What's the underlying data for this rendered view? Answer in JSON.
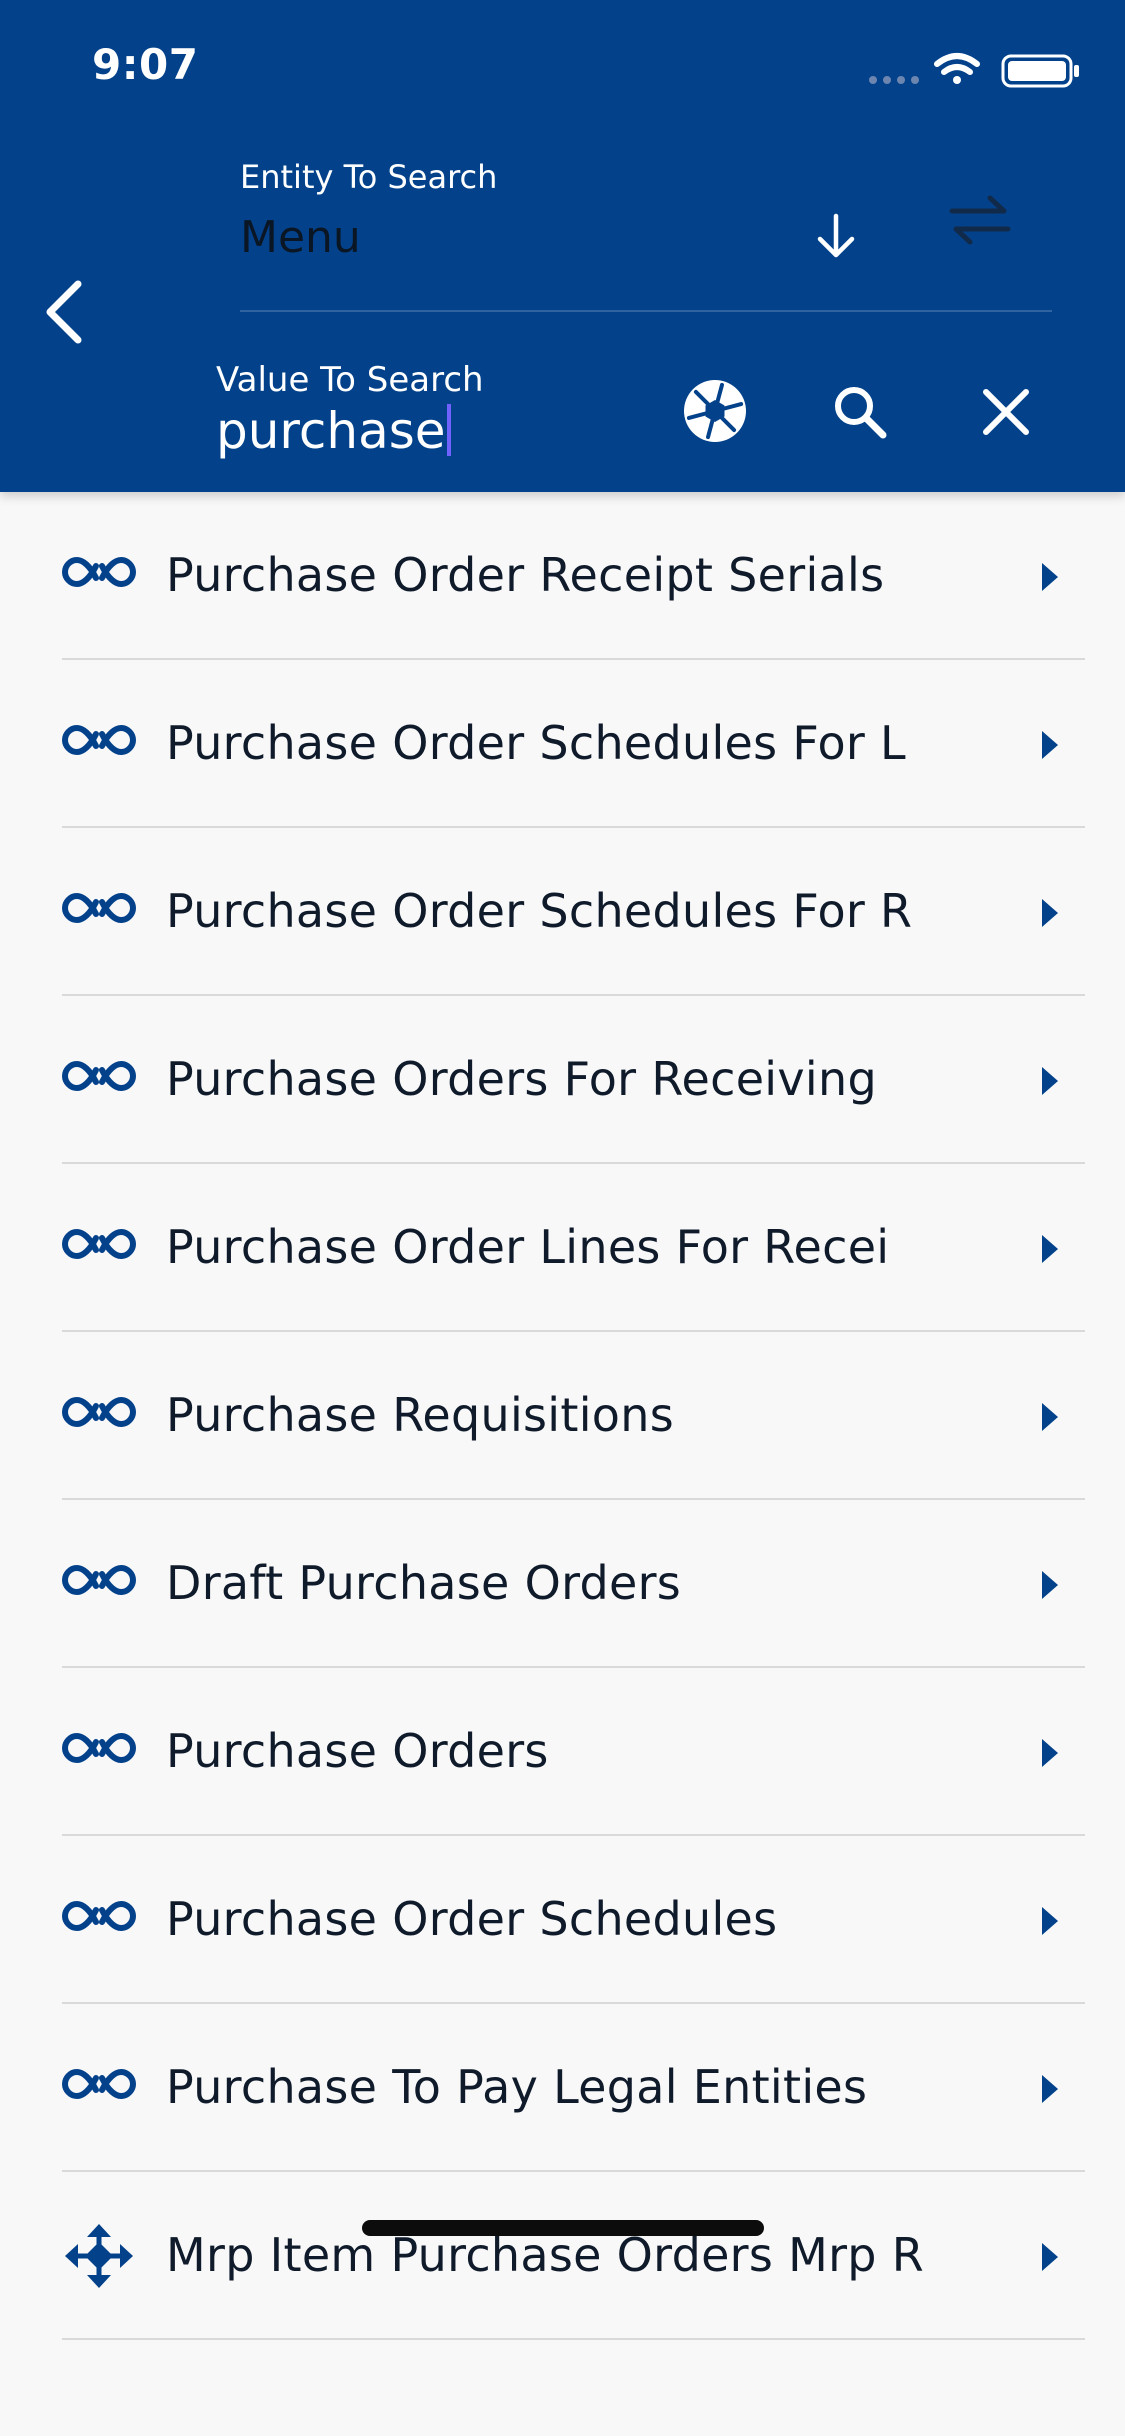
{
  "status_bar": {
    "time": "9:07",
    "icons": [
      "cellular-signal-icon",
      "wifi-icon",
      "battery-icon"
    ]
  },
  "header": {
    "background_color": "#03428b",
    "entity_label": "Entity To Search",
    "entity_value": "Menu",
    "value_label": "Value To Search",
    "value_input": "purchase",
    "caret_color": "#6f62ff",
    "icons": {
      "back": "back-chevron-icon",
      "entity_dropdown": "arrow-down-icon",
      "swap": "swap-arrows-icon",
      "camera": "camera-aperture-icon",
      "search": "search-icon",
      "close": "close-icon"
    }
  },
  "results": {
    "accent_color": "#03428b",
    "items": [
      {
        "label": "Purchase Order Receipt Serials",
        "icon": "link-icon"
      },
      {
        "label": "Purchase Order Schedules For L",
        "icon": "link-icon"
      },
      {
        "label": "Purchase Order Schedules For R",
        "icon": "link-icon"
      },
      {
        "label": "Purchase Orders For Receiving",
        "icon": "link-icon"
      },
      {
        "label": "Purchase Order Lines For Recei",
        "icon": "link-icon"
      },
      {
        "label": "Purchase Requisitions",
        "icon": "link-icon"
      },
      {
        "label": "Draft Purchase Orders",
        "icon": "link-icon"
      },
      {
        "label": "Purchase Orders",
        "icon": "link-icon"
      },
      {
        "label": "Purchase Order Schedules",
        "icon": "link-icon"
      },
      {
        "label": "Purchase To Pay Legal Entities",
        "icon": "link-icon"
      },
      {
        "label": "Mrp Item Purchase Orders Mrp R",
        "icon": "move-arrows-icon"
      }
    ]
  }
}
